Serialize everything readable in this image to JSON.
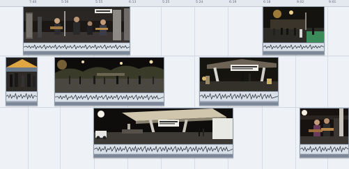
{
  "app": {
    "view": "multi-camera timeline"
  },
  "ruler": {
    "labels": [
      "7:40",
      "5:56",
      "5:55",
      "6:13",
      "5:25",
      "5:24",
      "6:19",
      "6:18",
      "9:02",
      "9:01"
    ]
  },
  "clips": [
    {
      "id": "cam1-a",
      "track": 1,
      "scene": "Band performing on stage"
    },
    {
      "id": "cam1-b",
      "track": 1,
      "scene": "Crowd at night plaza"
    },
    {
      "id": "cam2-a",
      "track": 2,
      "scene": "Tent crowd"
    },
    {
      "id": "cam2-b",
      "track": 2,
      "scene": "Night plaza wide shot"
    },
    {
      "id": "cam2-c",
      "track": 2,
      "scene": "Stage with banner"
    },
    {
      "id": "cam3-a",
      "track": 3,
      "scene": "Outdoor stage with canopy"
    },
    {
      "id": "cam3-b",
      "track": 3,
      "scene": "Guitarist close-up"
    }
  ],
  "colors": {
    "background": "#eef1f5",
    "clip_frame": "#b9c3cf",
    "audio_bg": "#d9dfe7"
  }
}
